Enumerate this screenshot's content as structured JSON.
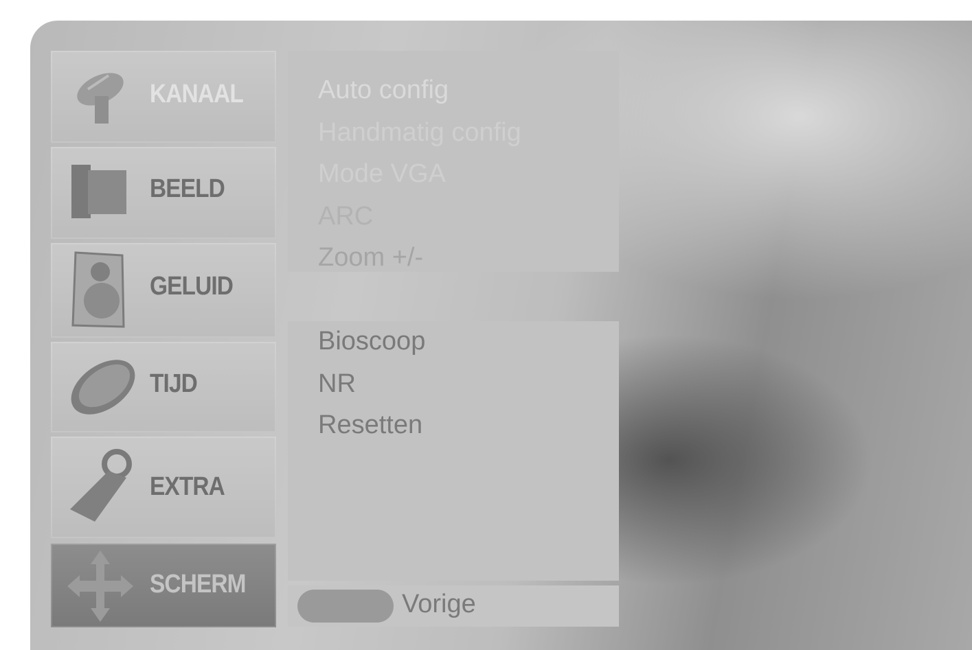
{
  "menu": {
    "items": [
      {
        "label": "KANAAL",
        "icon": "satellite-dish-icon"
      },
      {
        "label": "BEELD",
        "icon": "picture-icon"
      },
      {
        "label": "GELUID",
        "icon": "speaker-icon"
      },
      {
        "label": "TIJD",
        "icon": "clock-icon"
      },
      {
        "label": "EXTRA",
        "icon": "tag-icon"
      },
      {
        "label": "SCHERM",
        "icon": "move-arrows-icon"
      }
    ],
    "active_index": 5
  },
  "submenu": {
    "group1": [
      "Auto config",
      "Handmatig config",
      "Mode VGA",
      "ARC",
      "Zoom +/-"
    ],
    "group2": [
      "Bioscoop",
      "NR",
      "Resetten"
    ]
  },
  "footer": {
    "back_label": "Vorige"
  },
  "colors": {
    "panel": "#bdbdbd",
    "active_item": "#808080",
    "text": "#7a7a7a"
  }
}
